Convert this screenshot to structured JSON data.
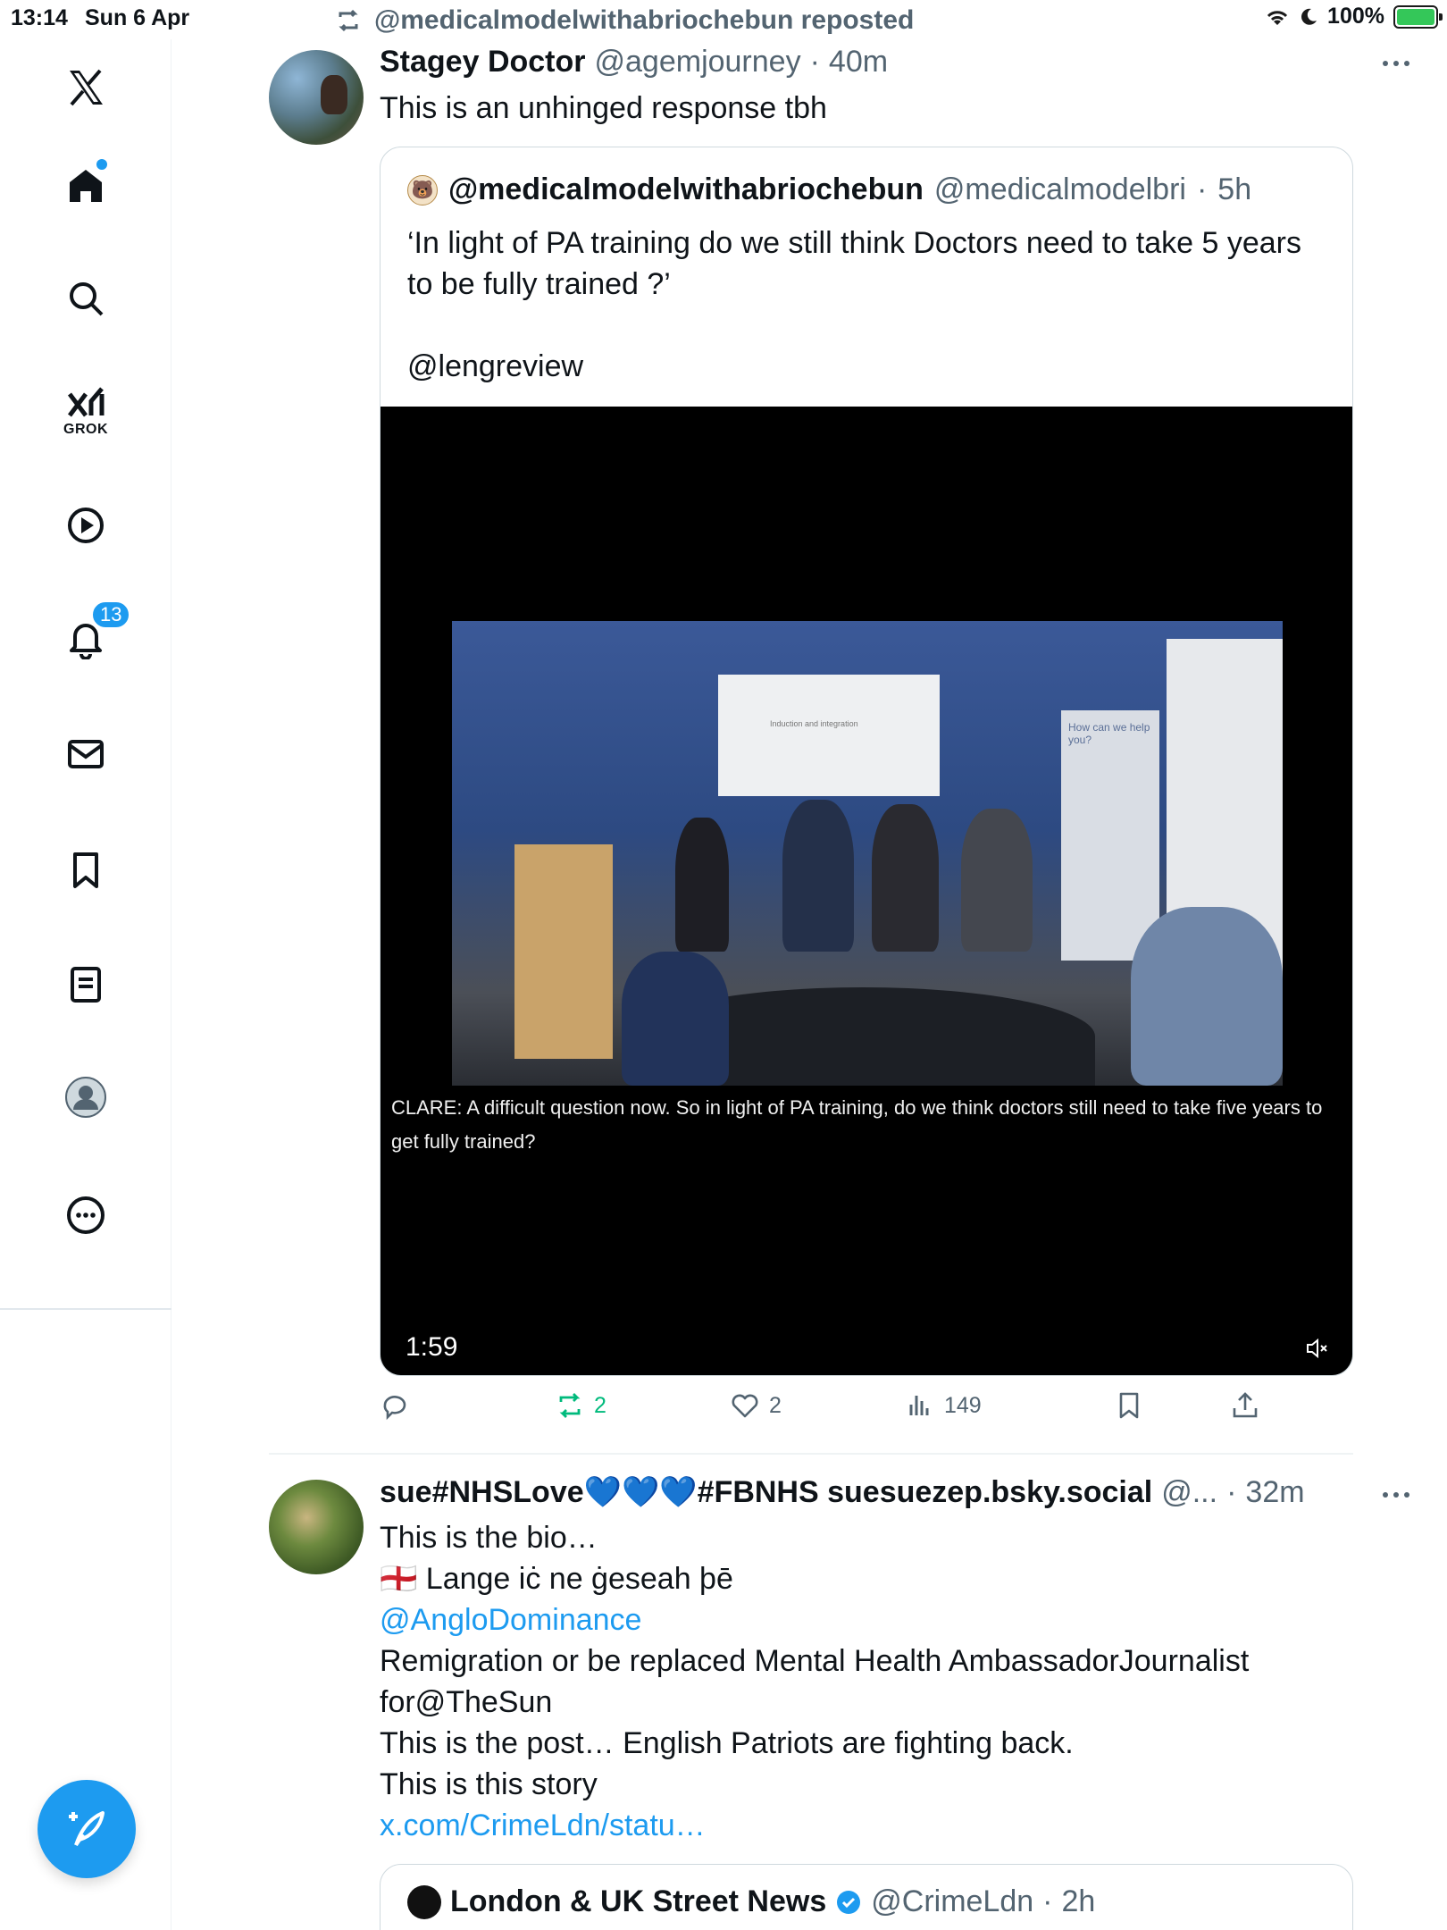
{
  "status_bar": {
    "time": "13:14",
    "date": "Sun 6 Apr",
    "battery": "100%"
  },
  "sidebar": {
    "logo": "x-logo-icon",
    "items": [
      {
        "name": "home",
        "icon": "home-icon"
      },
      {
        "name": "search",
        "icon": "search-icon"
      },
      {
        "name": "grok",
        "icon": "grok-icon",
        "label": "GROK"
      },
      {
        "name": "videos",
        "icon": "play-icon"
      },
      {
        "name": "notifications",
        "icon": "bell-icon",
        "badge": "13"
      },
      {
        "name": "messages",
        "icon": "mail-icon"
      },
      {
        "name": "bookmarks",
        "icon": "bookmark-icon"
      },
      {
        "name": "lists",
        "icon": "list-icon"
      },
      {
        "name": "profile",
        "icon": "avatar-icon"
      },
      {
        "name": "more",
        "icon": "more-icon"
      }
    ],
    "compose": "compose-icon"
  },
  "feed": {
    "repost_label": "@medicalmodelwithabriochebun reposted",
    "tweet1": {
      "name": "Stagey Doctor",
      "handle": "@agemjourney",
      "time": "40m",
      "text": "This is an unhinged response tbh",
      "quote": {
        "name": "@medicalmodelwithabriochebun",
        "handle": "@medicalmodelbri",
        "time": "5h",
        "text_line1": "‘In light of PA training do we still think Doctors need to take 5 years to be fully trained ?’",
        "text_line2": "@lengreview",
        "video": {
          "subtitle": "CLARE:  A difficult question now.  So in light of PA training, do we think doctors still need to take five years to get fully trained?",
          "duration": "1:59",
          "slide_text": "Induction and integration",
          "banner_text": "How can we help you?"
        }
      },
      "actions": {
        "replies": "",
        "reposts": "2",
        "likes": "2",
        "views": "149"
      }
    },
    "tweet2": {
      "name": "sue#NHSLove💙💙💙#FBNHS suesuezep.bsky.social",
      "handle": "@...",
      "time": "32m",
      "lines": [
        "This is the bio…",
        "Lange iċ ne ġeseah þē",
        "@AngloDominance",
        "Remigration or be replaced Mental Health AmbassadorJournalist",
        "for@TheSun",
        "This is the post… English Patriots are fighting back.",
        "This is this story",
        "x.com/CrimeLdn/statu…"
      ],
      "flag": "🏴󠁧󠁢󠁥󠁮󠁧󠁿",
      "quote": {
        "name": "London & UK Street News",
        "handle": "@CrimeLdn",
        "time": "2h"
      }
    }
  },
  "colors": {
    "accent": "#1d9bf0",
    "repost_green": "#00ba7c",
    "muted": "#536471"
  }
}
